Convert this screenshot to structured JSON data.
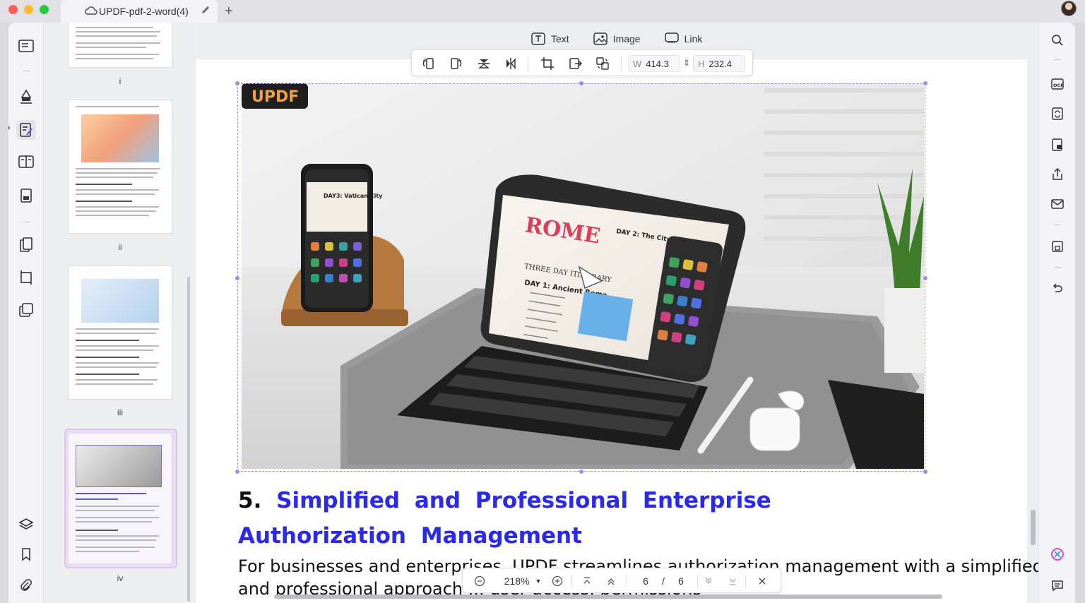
{
  "tab": {
    "title": "UPDF-pdf-2-word(4)"
  },
  "thumbnails": [
    {
      "label": "i"
    },
    {
      "label": "ii"
    },
    {
      "label": "iii"
    },
    {
      "label": "iv"
    }
  ],
  "edit_menu": {
    "text": "Text",
    "image": "Image",
    "link": "Link"
  },
  "image_toolbar": {
    "w_label": "W",
    "w_value": "414.3",
    "h_label": "H",
    "h_value": "232.4"
  },
  "photo": {
    "logo": "UPDF"
  },
  "content": {
    "heading_number": "5.",
    "heading_text": "Simplified and Professional Enterprise Authorization Management",
    "body_line1": "For businesses and enterprises, UPDF streamlines authorization management with a simplified",
    "body_line2": "and professional approach ... user access, permissions"
  },
  "nav": {
    "zoom": "218%",
    "current_page": "6",
    "separator": "/",
    "total_pages": "6"
  },
  "colors": {
    "accent": "#2a2aee",
    "selection": "#a890d8"
  }
}
